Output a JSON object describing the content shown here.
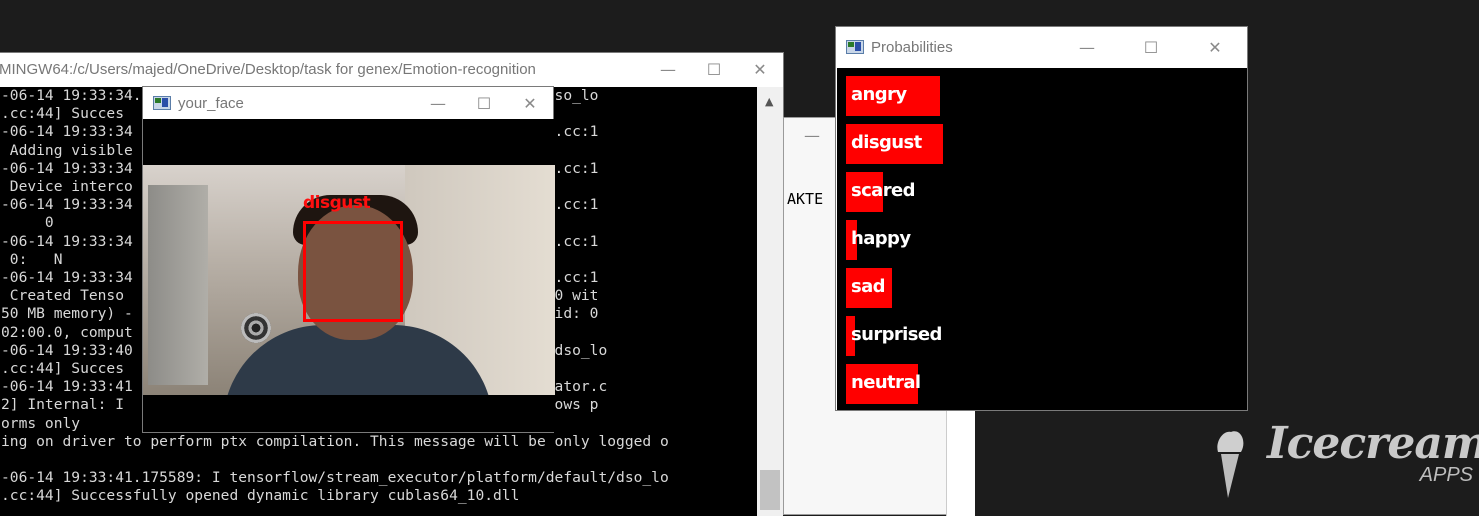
{
  "terminal": {
    "title": "MINGW64:/c/Users/majed/OneDrive/Desktop/task for genex/Emotion-recognition",
    "lines": [
      "-06-14 19:33:34.                               atform/default/dso_lo",
      ".cc:44] Succes                                 ll",
      "-06-14 19:33:34                                 /gpu/gpu_device.cc:1",
      " Adding visible",
      "-06-14 19:33:34                                 /gpu/gpu_device.cc:1",
      " Device interco                                e matrix:",
      "-06-14 19:33:34                                 /gpu/gpu_device.cc:1",
      "     0",
      "-06-14 19:33:34                                 /gpu/gpu_device.cc:1",
      " 0:   N",
      "-06-14 19:33:34                                 /gpu/gpu_device.cc:1",
      " Created Tenso                                 sk:0/device:GPU:0 wit",
      "50 MB memory) -                                 MX150, pci bus id: 0",
      "02:00.0, comput",
      "-06-14 19:33:40                                 atform/default/dso_lo",
      ".cc:44] Succes                                 ll",
      "-06-14 19:33:41                                 u/redzone_allocator.c",
      "2] Internal: I                                 on Cuda non-Windows p",
      "orms only",
      "ing on driver to perform ptx compilation. This message will be only logged o",
      "",
      "-06-14 19:33:41.175589: I tensorflow/stream_executor/platform/default/dso_lo",
      ".cc:44] Successfully opened dynamic library cublas64_10.dll"
    ]
  },
  "blank_window": {
    "text_fragment": "AKTE"
  },
  "face_window": {
    "title": "your_face",
    "detected_label": "disgust"
  },
  "probabilities": {
    "title": "Probabilities",
    "emotions": [
      {
        "label": "angry",
        "value": 0.33
      },
      {
        "label": "disgust",
        "value": 0.34
      },
      {
        "label": "scared",
        "value": 0.13
      },
      {
        "label": "happy",
        "value": 0.04
      },
      {
        "label": "sad",
        "value": 0.16
      },
      {
        "label": "surprised",
        "value": 0.03
      },
      {
        "label": "neutral",
        "value": 0.25
      }
    ],
    "bar_color": "#ff0000"
  },
  "window_controls": {
    "minimize": "—",
    "maximize": "☐",
    "close": "✕"
  },
  "watermark": {
    "brand": "Icecream",
    "sub": "APPS"
  }
}
